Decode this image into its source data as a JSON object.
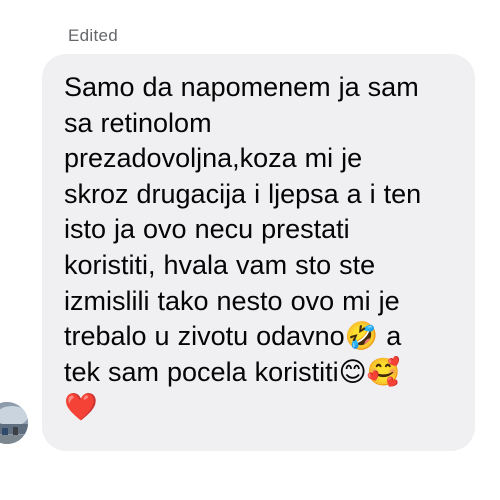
{
  "comment": {
    "edited_label": "Edited",
    "message": "Samo da napomenem ja sam\nsa retinolom\nprezadovoljna,koza mi je\nskroz drugacija i ljepsa a i ten\nisto ja ovo necu prestati\nkoristiti, hvala vam sto ste\nizmislili tako nesto ovo mi je\ntrebalo u zivotu odavno🤣 a\ntek sam pocela koristiti😊🥰\n❤️"
  },
  "colors": {
    "bubble_background": "#f0f0f3",
    "text": "#050505",
    "meta_text": "#65676b"
  },
  "icons": {
    "avatar": "profile-photo"
  }
}
